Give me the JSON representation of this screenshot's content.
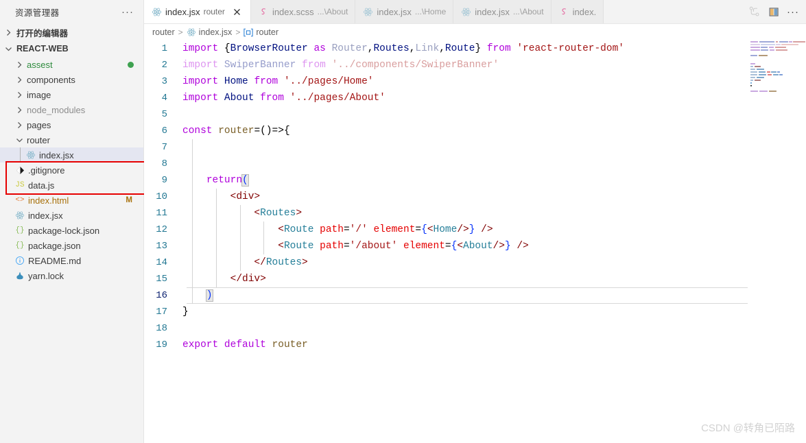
{
  "sidebar": {
    "title": "资源管理器",
    "more_label": "···",
    "open_editors_label": "打开的编辑器",
    "project_label": "REACT-WEB",
    "folders": [
      {
        "label": "assest",
        "color": "#2e8b3d",
        "badge_dot": "#3ea150",
        "expanded": false
      },
      {
        "label": "components",
        "color": "#3b3b3b",
        "badge_dot": "",
        "expanded": false
      },
      {
        "label": "image",
        "color": "#3b3b3b",
        "badge_dot": "",
        "expanded": false
      },
      {
        "label": "node_modules",
        "color": "#8c8c8c",
        "badge_dot": "",
        "expanded": false
      },
      {
        "label": "pages",
        "color": "#3b3b3b",
        "badge_dot": "",
        "expanded": false
      },
      {
        "label": "router",
        "color": "#3b3b3b",
        "badge_dot": "",
        "expanded": true
      }
    ],
    "router_child": {
      "label": "index.jsx",
      "icon": "react-icon",
      "selected": true
    },
    "files": [
      {
        "label": ".gitignore",
        "icon": "git-icon",
        "icon_text": "◈",
        "icon_color": "#1c1c1c",
        "badge": "",
        "color": "#3b3b3b"
      },
      {
        "label": "data.js",
        "icon": "js-icon",
        "icon_text": "JS",
        "icon_color": "#cbcb41",
        "badge": "",
        "color": "#3b3b3b"
      },
      {
        "label": "index.html",
        "icon": "html-icon",
        "icon_text": "<>",
        "icon_color": "#e37933",
        "badge": "M",
        "badge_color": "#a8700a",
        "color": "#a8700a"
      },
      {
        "label": "index.jsx",
        "icon": "react-icon",
        "icon_text": "⚛",
        "icon_color": "#7fb4c9",
        "badge": "",
        "color": "#3b3b3b"
      },
      {
        "label": "package-lock.json",
        "icon": "json-icon",
        "icon_text": "{}",
        "icon_color": "#8bbd5c",
        "badge": "",
        "color": "#3b3b3b"
      },
      {
        "label": "package.json",
        "icon": "json-icon",
        "icon_text": "{}",
        "icon_color": "#8bbd5c",
        "badge": "",
        "color": "#3b3b3b"
      },
      {
        "label": "README.md",
        "icon": "info-icon",
        "icon_text": "ⓘ",
        "icon_color": "#42a5f5",
        "badge": "",
        "color": "#3b3b3b"
      },
      {
        "label": "yarn.lock",
        "icon": "yarn-icon",
        "icon_text": "🐾",
        "icon_color": "#2c8ebb",
        "badge": "",
        "color": "#3b3b3b"
      }
    ],
    "annotation_color": "#e60000"
  },
  "tabs": [
    {
      "icon": "react-icon",
      "name": "index.jsx",
      "desc": "router",
      "active": true,
      "has_close": true
    },
    {
      "icon": "sass-icon",
      "name": "index.scss",
      "desc": "...\\About",
      "active": false,
      "has_close": false
    },
    {
      "icon": "react-icon",
      "name": "index.jsx",
      "desc": "...\\Home",
      "active": false,
      "has_close": false
    },
    {
      "icon": "react-icon",
      "name": "index.jsx",
      "desc": "...\\About",
      "active": false,
      "has_close": false
    },
    {
      "icon": "sass-icon",
      "name": "index.",
      "desc": "",
      "active": false,
      "has_close": false
    }
  ],
  "tab_actions": [
    {
      "name": "run-and-debug-icon",
      "glyph": "⤸"
    },
    {
      "name": "split-editor-icon",
      "glyph": "▯▯"
    },
    {
      "name": "more-actions-icon",
      "glyph": "···"
    }
  ],
  "breadcrumb": [
    {
      "icon": "",
      "label": "router"
    },
    {
      "icon": "react-icon",
      "label": "index.jsx"
    },
    {
      "icon": "symbol-variable-icon",
      "label": "router"
    }
  ],
  "breadcrumb_separator": ">",
  "editor": {
    "language": "jsx",
    "current_line": 16,
    "lines": [
      {
        "n": 1,
        "tokens": [
          {
            "t": "import",
            "c": "k"
          },
          {
            "t": " ",
            "c": "op"
          },
          {
            "t": "{",
            "c": "op"
          },
          {
            "t": "BrowserRouter",
            "c": "var"
          },
          {
            "t": " ",
            "c": "op"
          },
          {
            "t": "as",
            "c": "k"
          },
          {
            "t": " ",
            "c": "op"
          },
          {
            "t": "Router",
            "c": "dim"
          },
          {
            "t": ",",
            "c": "op"
          },
          {
            "t": "Routes",
            "c": "var"
          },
          {
            "t": ",",
            "c": "op"
          },
          {
            "t": "Link",
            "c": "dim"
          },
          {
            "t": ",",
            "c": "op"
          },
          {
            "t": "Route",
            "c": "var"
          },
          {
            "t": "}",
            "c": "op"
          },
          {
            "t": " ",
            "c": "op"
          },
          {
            "t": "from",
            "c": "k"
          },
          {
            "t": " ",
            "c": "op"
          },
          {
            "t": "'react-router-dom'",
            "c": "str"
          }
        ]
      },
      {
        "n": 2,
        "faded": true,
        "tokens": [
          {
            "t": "import",
            "c": "k"
          },
          {
            "t": " ",
            "c": "op"
          },
          {
            "t": "SwiperBanner",
            "c": "var"
          },
          {
            "t": " ",
            "c": "op"
          },
          {
            "t": "from",
            "c": "k"
          },
          {
            "t": " ",
            "c": "op"
          },
          {
            "t": "'../components/SwiperBanner'",
            "c": "str"
          }
        ]
      },
      {
        "n": 3,
        "tokens": [
          {
            "t": "import",
            "c": "k"
          },
          {
            "t": " ",
            "c": "op"
          },
          {
            "t": "Home",
            "c": "var"
          },
          {
            "t": " ",
            "c": "op"
          },
          {
            "t": "from",
            "c": "k"
          },
          {
            "t": " ",
            "c": "op"
          },
          {
            "t": "'../pages/Home'",
            "c": "str"
          }
        ]
      },
      {
        "n": 4,
        "tokens": [
          {
            "t": "import",
            "c": "k"
          },
          {
            "t": " ",
            "c": "op"
          },
          {
            "t": "About",
            "c": "var"
          },
          {
            "t": " ",
            "c": "op"
          },
          {
            "t": "from",
            "c": "k"
          },
          {
            "t": " ",
            "c": "op"
          },
          {
            "t": "'../pages/About'",
            "c": "str"
          }
        ]
      },
      {
        "n": 5,
        "tokens": []
      },
      {
        "n": 6,
        "tokens": [
          {
            "t": "const",
            "c": "k"
          },
          {
            "t": " ",
            "c": "op"
          },
          {
            "t": "router",
            "c": "fn"
          },
          {
            "t": "=()=>{",
            "c": "op"
          }
        ]
      },
      {
        "n": 7,
        "tokens": []
      },
      {
        "n": 8,
        "tokens": []
      },
      {
        "n": 9,
        "tokens": [
          {
            "t": "    ",
            "c": "op"
          },
          {
            "t": "return",
            "c": "k"
          },
          {
            "t": "(",
            "c": "brk"
          }
        ]
      },
      {
        "n": 10,
        "tokens": [
          {
            "t": "        ",
            "c": "op"
          },
          {
            "t": "<div>",
            "c": "tag"
          }
        ]
      },
      {
        "n": 11,
        "tokens": [
          {
            "t": "            ",
            "c": "op"
          },
          {
            "t": "<",
            "c": "tag"
          },
          {
            "t": "Routes",
            "c": "ctag"
          },
          {
            "t": ">",
            "c": "tag"
          }
        ]
      },
      {
        "n": 12,
        "tokens": [
          {
            "t": "                ",
            "c": "op"
          },
          {
            "t": "<",
            "c": "tag"
          },
          {
            "t": "Route",
            "c": "ctag"
          },
          {
            "t": " ",
            "c": "op"
          },
          {
            "t": "path",
            "c": "attr"
          },
          {
            "t": "=",
            "c": "op"
          },
          {
            "t": "'/'",
            "c": "str"
          },
          {
            "t": " ",
            "c": "op"
          },
          {
            "t": "element",
            "c": "attr"
          },
          {
            "t": "=",
            "c": "op"
          },
          {
            "t": "{",
            "c": "brc"
          },
          {
            "t": "<",
            "c": "tag"
          },
          {
            "t": "Home",
            "c": "ctag"
          },
          {
            "t": "/>",
            "c": "tag"
          },
          {
            "t": "}",
            "c": "brc"
          },
          {
            "t": " ",
            "c": "op"
          },
          {
            "t": "/>",
            "c": "tag"
          }
        ]
      },
      {
        "n": 13,
        "tokens": [
          {
            "t": "                ",
            "c": "op"
          },
          {
            "t": "<",
            "c": "tag"
          },
          {
            "t": "Route",
            "c": "ctag"
          },
          {
            "t": " ",
            "c": "op"
          },
          {
            "t": "path",
            "c": "attr"
          },
          {
            "t": "=",
            "c": "op"
          },
          {
            "t": "'/about'",
            "c": "str"
          },
          {
            "t": " ",
            "c": "op"
          },
          {
            "t": "element",
            "c": "attr"
          },
          {
            "t": "=",
            "c": "op"
          },
          {
            "t": "{",
            "c": "brc"
          },
          {
            "t": "<",
            "c": "tag"
          },
          {
            "t": "About",
            "c": "ctag"
          },
          {
            "t": "/>",
            "c": "tag"
          },
          {
            "t": "}",
            "c": "brc"
          },
          {
            "t": " ",
            "c": "op"
          },
          {
            "t": "/>",
            "c": "tag"
          }
        ]
      },
      {
        "n": 14,
        "tokens": [
          {
            "t": "            ",
            "c": "op"
          },
          {
            "t": "</",
            "c": "tag"
          },
          {
            "t": "Routes",
            "c": "ctag"
          },
          {
            "t": ">",
            "c": "tag"
          }
        ]
      },
      {
        "n": 15,
        "tokens": [
          {
            "t": "        ",
            "c": "op"
          },
          {
            "t": "</div>",
            "c": "tag"
          }
        ]
      },
      {
        "n": 16,
        "tokens": [
          {
            "t": "    ",
            "c": "op"
          },
          {
            "t": ")",
            "c": "brk"
          }
        ]
      },
      {
        "n": 17,
        "tokens": [
          {
            "t": "}",
            "c": "op"
          }
        ]
      },
      {
        "n": 18,
        "tokens": []
      },
      {
        "n": 19,
        "tokens": [
          {
            "t": "export",
            "c": "k"
          },
          {
            "t": " ",
            "c": "op"
          },
          {
            "t": "default",
            "c": "k"
          },
          {
            "t": " ",
            "c": "op"
          },
          {
            "t": "router",
            "c": "fn"
          }
        ]
      }
    ],
    "indent_guides": [
      {
        "line_from": 7,
        "line_to": 16,
        "col": 0
      },
      {
        "line_from": 10,
        "line_to": 15,
        "col": 1
      },
      {
        "line_from": 11,
        "line_to": 14,
        "col": 2
      },
      {
        "line_from": 12,
        "line_to": 13,
        "col": 3
      }
    ]
  },
  "minimap": {
    "rows": [
      [
        {
          "w": 26,
          "c": "#c9a8e0"
        },
        {
          "w": 52,
          "c": "#9ea8d8"
        },
        {
          "w": 8,
          "c": "#d8a0a0"
        },
        {
          "w": 30,
          "c": "#9ea8d8"
        },
        {
          "w": 10,
          "c": "#c9a8e0"
        },
        {
          "w": 40,
          "c": "#d8a0a0"
        }
      ],
      [
        {
          "w": 26,
          "c": "#ddd0ea"
        },
        {
          "w": 40,
          "c": "#cfd4ec"
        },
        {
          "w": 12,
          "c": "#ddd0ea"
        },
        {
          "w": 48,
          "c": "#ecc8c8"
        }
      ],
      [
        {
          "w": 26,
          "c": "#c9a8e0"
        },
        {
          "w": 20,
          "c": "#9ea8d8"
        },
        {
          "w": 14,
          "c": "#c9a8e0"
        },
        {
          "w": 32,
          "c": "#d8a0a0"
        }
      ],
      [
        {
          "w": 26,
          "c": "#c9a8e0"
        },
        {
          "w": 22,
          "c": "#9ea8d8"
        },
        {
          "w": 14,
          "c": "#c9a8e0"
        },
        {
          "w": 34,
          "c": "#d8a0a0"
        }
      ],
      [],
      [
        {
          "w": 20,
          "c": "#9ea8d8"
        },
        {
          "w": 26,
          "c": "#b39a78"
        }
      ],
      [],
      [],
      [
        {
          "w": 14,
          "c": "#c9a8e0"
        }
      ],
      [
        {
          "w": 8,
          "c": "#a8bfd8"
        },
        {
          "w": 18,
          "c": "#b08080"
        }
      ],
      [
        {
          "w": 14,
          "c": "#a8bfd8"
        },
        {
          "w": 22,
          "c": "#7fa8cc"
        }
      ],
      [
        {
          "w": 20,
          "c": "#a8bfd8"
        },
        {
          "w": 20,
          "c": "#7fa8cc"
        },
        {
          "w": 10,
          "c": "#e08080"
        },
        {
          "w": 14,
          "c": "#7fa8cc"
        },
        {
          "w": 8,
          "c": "#7f9fd8"
        }
      ],
      [
        {
          "w": 20,
          "c": "#a8bfd8"
        },
        {
          "w": 22,
          "c": "#7fa8cc"
        },
        {
          "w": 12,
          "c": "#e08080"
        },
        {
          "w": 16,
          "c": "#7fa8cc"
        },
        {
          "w": 8,
          "c": "#7f9fd8"
        }
      ],
      [
        {
          "w": 14,
          "c": "#a8bfd8"
        },
        {
          "w": 22,
          "c": "#7fa8cc"
        }
      ],
      [
        {
          "w": 8,
          "c": "#a8bfd8"
        },
        {
          "w": 18,
          "c": "#b08080"
        }
      ],
      [
        {
          "w": 4,
          "c": "#6fa8dc"
        }
      ],
      [
        {
          "w": 4,
          "c": "#444444"
        }
      ],
      [],
      [
        {
          "w": 22,
          "c": "#c9a8e0"
        },
        {
          "w": 24,
          "c": "#c9a8e0"
        },
        {
          "w": 22,
          "c": "#b39a78"
        }
      ]
    ]
  },
  "watermark": "CSDN @转角已陌路",
  "colors": {
    "accent_blue": "#0b216f",
    "selection": "#e4e6f1",
    "annotation_red": "#e60000",
    "tab_active_bg": "#ffffff",
    "tab_inactive_bg": "#ececec",
    "sidebar_bg": "#f3f3f3"
  }
}
